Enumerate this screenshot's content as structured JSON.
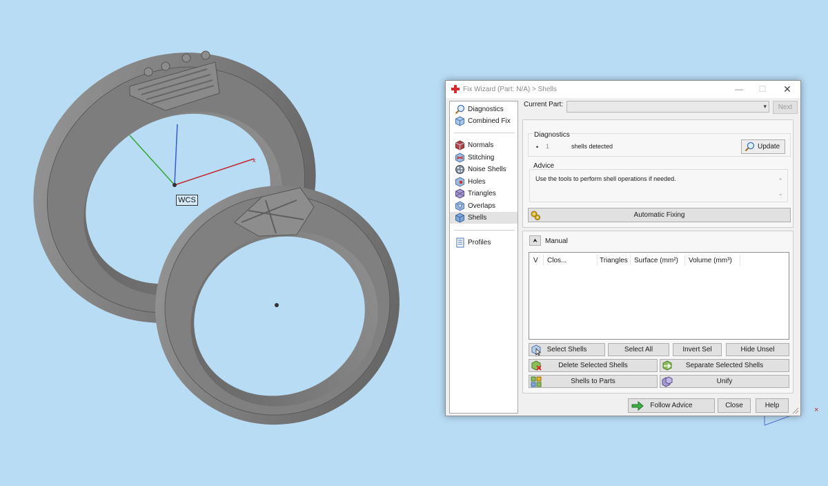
{
  "viewport": {
    "wcs_label": "WCS",
    "axis_colors": {
      "x": "#c0262b",
      "y": "#2ea82e",
      "z": "#2e5bd1"
    }
  },
  "window": {
    "title": "Fix Wizard (Part: N/A) > Shells",
    "title_icon": "red-cross-icon",
    "controls": {
      "minimize": "—",
      "maximize": "☐",
      "close": "✕"
    }
  },
  "nav": {
    "items": [
      {
        "label": "Diagnostics",
        "icon": "magnifier-icon"
      },
      {
        "label": "Combined Fix",
        "icon": "cube-icon"
      },
      {
        "label": "Normals",
        "icon": "normals-icon"
      },
      {
        "label": "Stitching",
        "icon": "stitching-icon"
      },
      {
        "label": "Noise Shells",
        "icon": "noise-shells-icon"
      },
      {
        "label": "Holes",
        "icon": "holes-icon"
      },
      {
        "label": "Triangles",
        "icon": "triangles-icon"
      },
      {
        "label": "Overlaps",
        "icon": "overlaps-icon"
      },
      {
        "label": "Shells",
        "icon": "shells-icon",
        "selected": true
      },
      {
        "label": "Profiles",
        "icon": "profiles-icon"
      }
    ]
  },
  "current_part": {
    "label": "Current Part:",
    "value": "",
    "next_label": "Next"
  },
  "diagnostics": {
    "title": "Diagnostics",
    "bullet": "•",
    "count": "1",
    "text": "shells detected",
    "update_label": "Update"
  },
  "advice": {
    "title": "Advice",
    "text": "Use the tools to perform shell operations if needed."
  },
  "automatic_fixing_label": "Automatic Fixing",
  "manual": {
    "collapse_glyph": "⮝",
    "title": "Manual",
    "columns": [
      "V",
      "Clos...",
      "Triangles",
      "Surface (mm²)",
      "Volume (mm³)"
    ],
    "rows": []
  },
  "buttons": {
    "select_shells": "Select Shells",
    "select_all": "Select All",
    "invert_sel": "Invert Sel",
    "hide_unsel": "Hide Unsel",
    "delete_selected": "Delete Selected Shells",
    "separate_selected": "Separate Selected Shells",
    "shells_to_parts": "Shells to Parts",
    "unify": "Unify"
  },
  "footer": {
    "follow_advice": "Follow Advice",
    "close": "Close",
    "help": "Help"
  }
}
